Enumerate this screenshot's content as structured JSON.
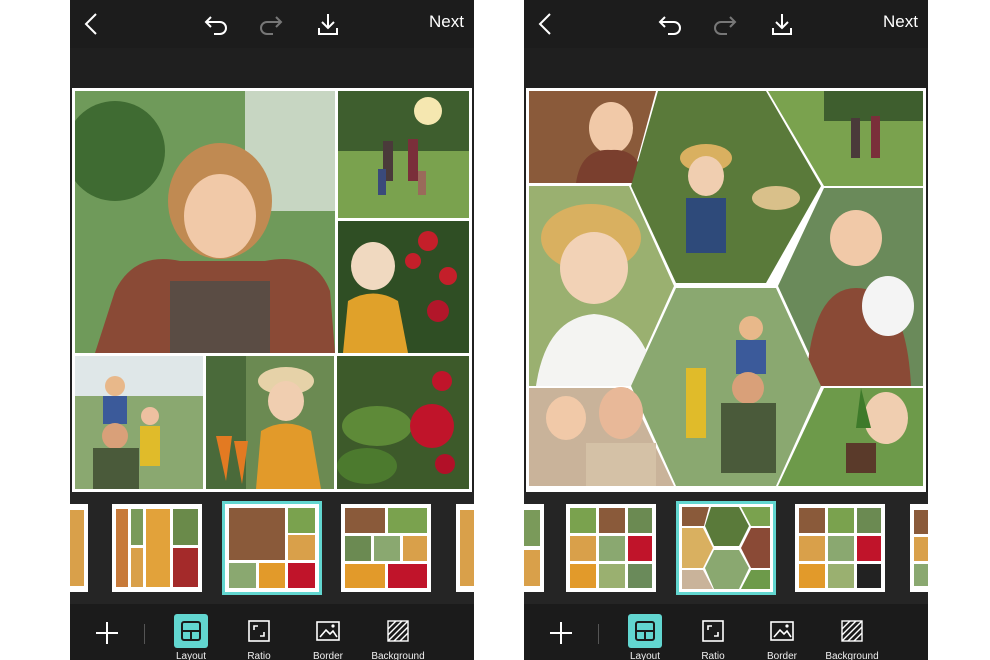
{
  "colors": {
    "accent": "#62d6d0",
    "bar_bg": "#1c1c1c",
    "strip_bg": "#252525",
    "text": "#ffffff"
  },
  "left_screen": {
    "header": {
      "next_label": "Next",
      "icons": [
        "back-icon",
        "undo-icon",
        "redo-icon",
        "download-icon"
      ]
    },
    "collage": {
      "style": "grid",
      "tiles": [
        "girl-portrait",
        "family-walking",
        "girl-with-roses",
        "father-kids",
        "girl-with-carrots",
        "red-rose"
      ]
    },
    "layout_thumbnails": {
      "count": 5,
      "selected_index": 2
    },
    "toolbar": {
      "add_icon": "plus-icon",
      "tools": [
        {
          "icon": "layout-icon",
          "label": "Layout",
          "active": true
        },
        {
          "icon": "ratio-icon",
          "label": "Ratio",
          "active": false
        },
        {
          "icon": "border-icon",
          "label": "Border",
          "active": false
        },
        {
          "icon": "background-icon",
          "label": "Background",
          "active": false
        }
      ]
    }
  },
  "right_screen": {
    "header": {
      "next_label": "Next",
      "icons": [
        "back-icon",
        "undo-icon",
        "redo-icon",
        "download-icon"
      ]
    },
    "collage": {
      "style": "hexagon",
      "tiles": [
        "girl-portrait",
        "boy-with-basket",
        "family-walking",
        "girl-in-hat",
        "girl-with-cat",
        "father-kids",
        "girl-with-mother",
        "child-with-plant"
      ]
    },
    "layout_thumbnails": {
      "count": 5,
      "selected_index": 2
    },
    "toolbar": {
      "add_icon": "plus-icon",
      "tools": [
        {
          "icon": "layout-icon",
          "label": "Layout",
          "active": true
        },
        {
          "icon": "ratio-icon",
          "label": "Ratio",
          "active": false
        },
        {
          "icon": "border-icon",
          "label": "Border",
          "active": false
        },
        {
          "icon": "background-icon",
          "label": "Background",
          "active": false
        }
      ]
    }
  }
}
